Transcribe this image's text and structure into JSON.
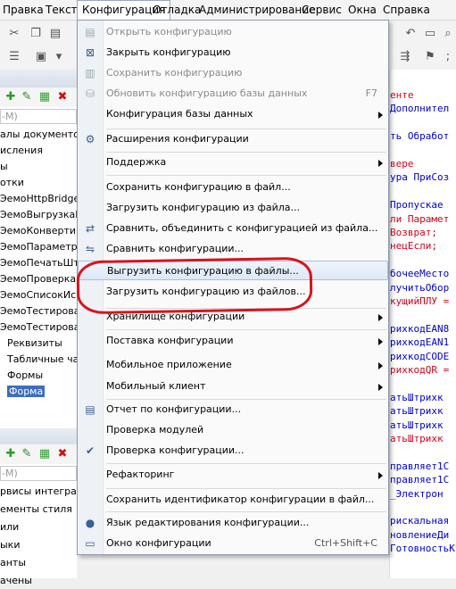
{
  "menubar": {
    "items": [
      "Правка",
      "Текст",
      "Конфигурация",
      "Отладка",
      "Администрирование",
      "Сервис",
      "Окна",
      "Справка"
    ]
  },
  "left_panel": {
    "search_placeholder": "-M)",
    "search_placeholder2": "-M)",
    "tree": [
      "алы документов",
      "исления",
      "ы",
      "отки",
      "ЭемоHttpBridge",
      "ЭемоВыгрузкаВВ",
      "ЭемоКонвертиро",
      "ЭемоПараметры",
      "ЭемоПечатьШтри",
      "ЭемоПроверкаМа",
      "ЭемоСписокИспо",
      "ЭемоТестирован",
      "ЭемоТестирован",
      "Реквизиты",
      "Табличные част",
      "Формы",
      "Форма"
    ],
    "tree2": [
      "рвисы интеграци",
      "ементы стиля",
      "или",
      "ыки",
      "анты",
      "ачены"
    ]
  },
  "editor": {
    "lines": [
      "енте",
      "Дополнител",
      "",
      "ть Обработ",
      "",
      "вере",
      "ура ПриСоз",
      "",
      "Пропускае",
      "ли Парамет",
      "   Возврат;",
      "нецЕсли;",
      "",
      "бочееМесто",
      "лучитьОбор",
      "кущийПЛУ =",
      "",
      "рихкодEAN8",
      "рихкодEAN1",
      "рихкодCODE",
      "рихкодQR =",
      "",
      "атьШтрихк",
      "атьШтрихк",
      "атьШтрихк",
      "атьШтрихк",
      "",
      "правляет1С",
      "правляет1С",
      "_Электрон",
      "",
      "рискальная",
      "новлениеДи",
      "ГотовностьКЕ"
    ]
  },
  "menu": {
    "title": "Конфигурация",
    "items": [
      {
        "label": "Открыть конфигурацию",
        "disabled": true,
        "icon": "open-config-icon"
      },
      {
        "label": "Закрыть конфигурацию",
        "disabled": false,
        "icon": "close-config-icon"
      },
      {
        "label": "Сохранить конфигурацию",
        "disabled": true,
        "icon": "save-config-icon"
      },
      {
        "label": "Обновить конфигурацию базы данных",
        "disabled": true,
        "shortcut": "F7",
        "icon": "update-db-icon"
      },
      {
        "label": "Конфигурация базы данных",
        "submenu": true
      },
      {
        "label": "Расширения конфигурации",
        "icon": "extensions-icon"
      },
      {
        "label": "Поддержка",
        "submenu": true
      },
      {
        "label": "Сохранить конфигурацию в файл..."
      },
      {
        "label": "Загрузить конфигурацию из файла..."
      },
      {
        "label": "Сравнить, объединить с конфигурацией из файла...",
        "icon": "compare-merge-icon"
      },
      {
        "label": "Сравнить конфигурации...",
        "icon": "compare-icon"
      },
      {
        "label": "Выгрузить конфигурацию в файлы...",
        "highlighted": true
      },
      {
        "label": "Загрузить конфигурацию из файлов..."
      },
      {
        "label": "Хранилище конфигурации",
        "submenu": true
      },
      {
        "label": "Поставка конфигурации",
        "submenu": true
      },
      {
        "label": "Мобильное приложение",
        "submenu": true
      },
      {
        "label": "Мобильный клиент",
        "submenu": true
      },
      {
        "label": "Отчет по конфигурации...",
        "icon": "report-icon"
      },
      {
        "label": "Проверка модулей"
      },
      {
        "label": "Проверка конфигурации...",
        "icon": "check-config-icon"
      },
      {
        "label": "Рефакторинг",
        "submenu": true
      },
      {
        "label": "Сохранить идентификатор конфигурации в файл..."
      },
      {
        "label": "Язык редактирования конфигурации...",
        "icon": "language-icon"
      },
      {
        "label": "Окно конфигурации",
        "shortcut": "Ctrl+Shift+C",
        "icon": "config-window-icon"
      }
    ]
  },
  "colors": {
    "accent": "#3d6cc0",
    "annotation": "#d8141a",
    "code_keyword": "#d0021b",
    "code_identifier": "#0000c8"
  }
}
